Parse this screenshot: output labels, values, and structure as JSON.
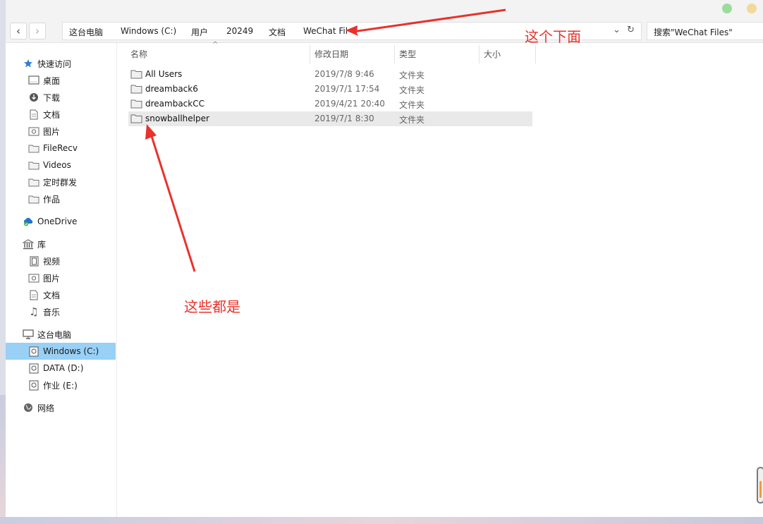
{
  "toolbar": {
    "breadcrumbs": [
      "这台电脑",
      "Windows (C:)",
      "用户",
      "20249",
      "文档",
      "WeChat Fil"
    ],
    "search_placeholder": "搜索\"WeChat Files\"",
    "dropdown_icon": "chevron-down-icon",
    "refresh_icon": "refresh-icon"
  },
  "sidebar": {
    "quick_access": "快速访问",
    "quick_items": [
      "桌面",
      "下载",
      "文档",
      "图片",
      "FileRecv",
      "Videos",
      "定时群发",
      "作品"
    ],
    "onedrive": "OneDrive",
    "library": "库",
    "library_items": [
      "视频",
      "图片",
      "文档",
      "音乐"
    ],
    "this_pc": "这台电脑",
    "drives": [
      "Windows (C:)",
      "DATA (D:)",
      "作业 (E:)"
    ],
    "selected": "Windows (C:)",
    "network": "网络"
  },
  "columns": {
    "name": "名称",
    "date": "修改日期",
    "type": "类型",
    "size": "大小"
  },
  "files": [
    {
      "name": "All Users",
      "date": "2019/7/8 9:46",
      "type": "文件夹"
    },
    {
      "name": "dreamback6",
      "date": "2019/7/1 17:54",
      "type": "文件夹"
    },
    {
      "name": "dreambackCC",
      "date": "2019/4/21 20:40",
      "type": "文件夹"
    },
    {
      "name": "snowballhelper",
      "date": "2019/7/1 8:30",
      "type": "文件夹"
    }
  ],
  "annotations": {
    "top_note": "这个下面",
    "bottom_note": "这些都是",
    "color": "#e8322b"
  },
  "window_controls": {
    "green": "#9bdc9b",
    "yellow": "#f4d899"
  }
}
